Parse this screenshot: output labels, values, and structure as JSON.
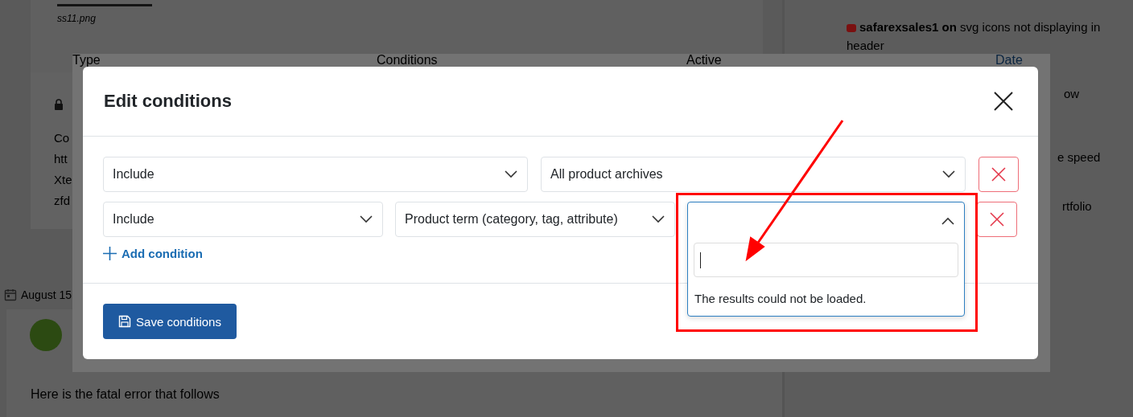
{
  "background": {
    "attachment_caption": "ss11.png",
    "post_lines": [
      "Co",
      "htt",
      "Xte",
      "zfd"
    ],
    "date": "August 15",
    "post_text": "Here is the fatal error that follows",
    "sidebar": {
      "author": "safarexsales1 on",
      "topic": "svg icons not displaying in header",
      "fragments": [
        "ow",
        "e speed",
        "rtfolio"
      ]
    }
  },
  "table_header": [
    "Type",
    "Conditions",
    "Active",
    "Date"
  ],
  "dialog": {
    "title": "Edit conditions",
    "rows": [
      {
        "fields": [
          {
            "value": "Include",
            "expanded": false
          },
          {
            "value": "All product archives",
            "expanded": false
          }
        ]
      },
      {
        "fields": [
          {
            "value": "Include",
            "expanded": false
          },
          {
            "value": "Product term (category, tag, attribute)",
            "expanded": false
          },
          {
            "expanded": true,
            "message": "The results could not be loaded."
          }
        ]
      }
    ],
    "add_button": "Add condition",
    "save_button": "Save conditions"
  }
}
